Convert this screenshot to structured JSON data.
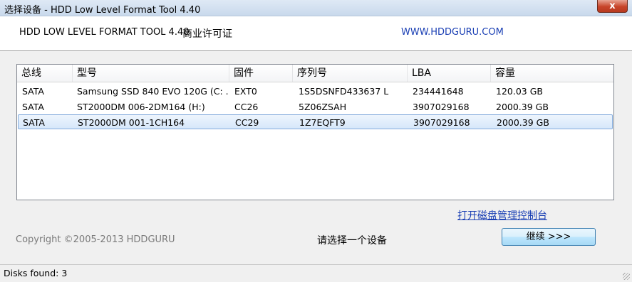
{
  "window": {
    "title": "选择设备 - HDD Low Level Format Tool 4.40",
    "close_glyph": "x"
  },
  "header": {
    "app_title": "HDD LOW LEVEL FORMAT TOOL 4.40",
    "license": "商业许可证",
    "website": "WWW.HDDGURU.COM"
  },
  "device_list": {
    "columns": [
      "总线",
      "型号",
      "固件",
      "序列号",
      "LBA",
      "容量"
    ],
    "rows": [
      {
        "bus": "SATA",
        "model": "Samsung SSD 840 EVO 120G (C: ...",
        "firmware": "EXT0",
        "serial": "1S5DSNFD433637 L",
        "lba": "234441648",
        "capacity": "120.03 GB",
        "selected": false
      },
      {
        "bus": "SATA",
        "model": "ST2000DM 006-2DM164 (H:)",
        "firmware": "CC26",
        "serial": "5Z06ZSAH",
        "lba": "3907029168",
        "capacity": "2000.39 GB",
        "selected": false
      },
      {
        "bus": "SATA",
        "model": "ST2000DM 001-1CH164",
        "firmware": "CC29",
        "serial": "1Z7EQFT9",
        "lba": "3907029168",
        "capacity": "2000.39 GB",
        "selected": true
      }
    ]
  },
  "footer": {
    "console_link": "打开磁盘管理控制台",
    "copyright": "Copyright ©2005-2013 HDDGURU",
    "prompt": "请选择一个设备",
    "continue_label": "继续 >>>"
  },
  "status": {
    "text": "Disks found: 3"
  }
}
